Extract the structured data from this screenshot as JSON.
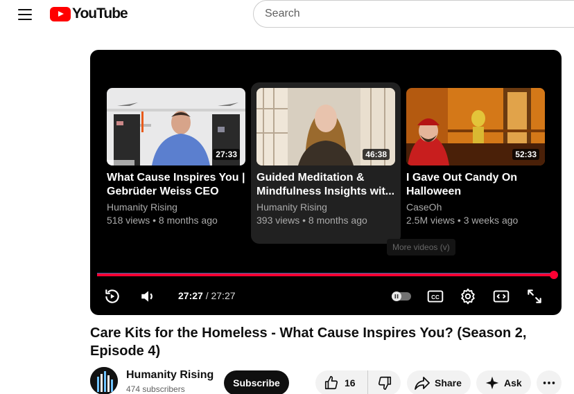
{
  "header": {
    "logo_text": "YouTube",
    "search_placeholder": "Search"
  },
  "player": {
    "end_cards": [
      {
        "duration": "27:33",
        "title": "What Cause Inspires You | Gebrüder Weiss CEO Mar...",
        "channel": "Humanity Rising",
        "meta": "518 views • 8 months ago"
      },
      {
        "duration": "46:38",
        "title": "Guided Meditation & Mindfulness Insights wit...",
        "channel": "Humanity Rising",
        "meta": "393 views • 8 months ago"
      },
      {
        "duration": "52:33",
        "title": "I Gave Out Candy On Halloween",
        "channel": "CaseOh",
        "meta": "2.5M views • 3 weeks ago"
      }
    ],
    "more_videos_label": "More videos (v)",
    "progress_fraction": 1.0,
    "time_current": "27:27",
    "time_separator": " / ",
    "time_total": "27:27"
  },
  "video": {
    "title": "Care Kits for the Homeless - What Cause Inspires You? (Season 2, Episode 4)"
  },
  "channel": {
    "name": "Humanity Rising",
    "subscribers": "474 subscribers",
    "subscribe_label": "Subscribe"
  },
  "actions": {
    "like_count": "16",
    "share_label": "Share",
    "ask_label": "Ask"
  },
  "colors": {
    "brand_red": "#ff0000",
    "progress_red": "#ff0033"
  },
  "icons": {
    "menu": "hamburger-icon",
    "replay": "replay-icon",
    "volume": "volume-icon",
    "autoplay": "autoplay-toggle-icon",
    "captions": "captions-icon",
    "settings": "gear-icon",
    "theater": "theater-mode-icon",
    "fullscreen": "fullscreen-icon",
    "like": "thumbs-up-icon",
    "dislike": "thumbs-down-icon",
    "share": "share-icon",
    "ask": "sparkle-icon",
    "more": "more-horizontal-icon"
  }
}
